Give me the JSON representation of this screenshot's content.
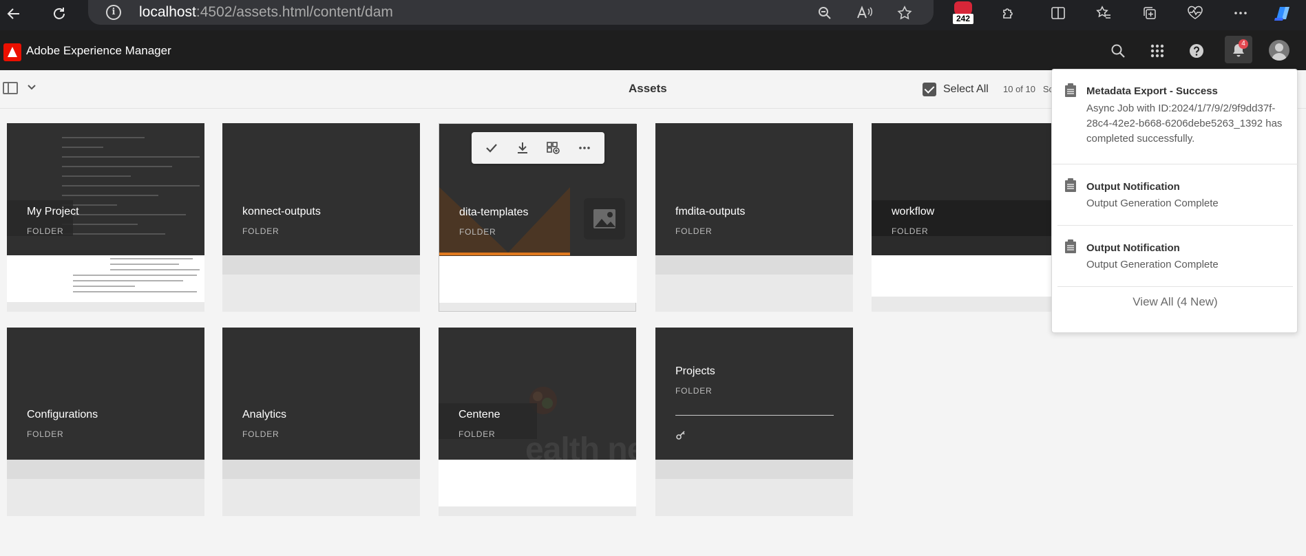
{
  "browser": {
    "url_host": "localhost",
    "url_rest": ":4502/assets.html/content/dam",
    "extension_badge": "242"
  },
  "app": {
    "title": "Adobe Experience Manager",
    "notification_count": "4"
  },
  "action_bar": {
    "title": "Assets",
    "select_all": "Select All",
    "count": "10 of 10",
    "count_suffix": "Sc"
  },
  "cards": [
    {
      "name": "My Project",
      "type": "FOLDER"
    },
    {
      "name": "konnect-outputs",
      "type": "FOLDER"
    },
    {
      "name": "dita-templates",
      "type": "FOLDER"
    },
    {
      "name": "fmdita-outputs",
      "type": "FOLDER"
    },
    {
      "name": "workflow",
      "type": "FOLDER"
    },
    {
      "name": "Configurations",
      "type": "FOLDER"
    },
    {
      "name": "Analytics",
      "type": "FOLDER"
    },
    {
      "name": "Centene",
      "type": "FOLDER"
    },
    {
      "name": "Projects",
      "type": "FOLDER"
    }
  ],
  "notifications": [
    {
      "title": "Metadata Export - Success",
      "body": "Async Job with ID:2024/1/7/9/2/9f9dd37f-28c4-42e2-b668-6206debe5263_1392 has completed successfully."
    },
    {
      "title": "Output Notification",
      "body": "Output Generation Complete"
    },
    {
      "title": "Output Notification",
      "body": "Output Generation Complete"
    }
  ],
  "view_all": "View All (4 New)",
  "centene_watermark": "ealth ne",
  "colors": {
    "header_bg": "#1e1e1e",
    "adobe_red": "#eb1000",
    "badge_red": "#e34850",
    "card_dark": "#303030",
    "accent_orange": "#e07a1f"
  }
}
